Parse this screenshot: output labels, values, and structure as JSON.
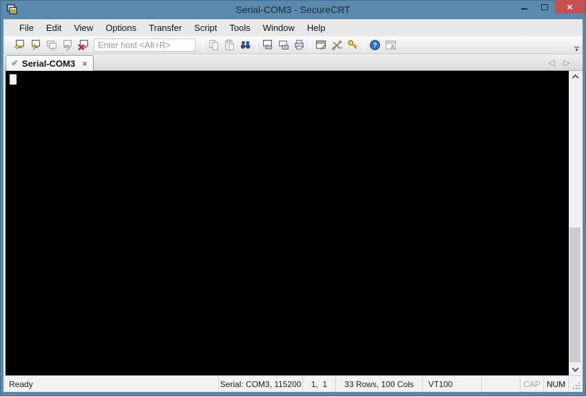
{
  "window": {
    "title": "Serial-COM3 - SecureCRT",
    "app_icon": "securecrt-stacked-windows",
    "controls": [
      "minimize",
      "maximize",
      "close"
    ],
    "close_glyph": "×"
  },
  "menu": {
    "items": [
      "File",
      "Edit",
      "View",
      "Options",
      "Transfer",
      "Script",
      "Tools",
      "Window",
      "Help"
    ]
  },
  "toolbar": {
    "host_placeholder": "Enter host <Alt+R>",
    "host_value": "",
    "overflow_glyph": "▾",
    "icons": [
      {
        "name": "quick-connect-icon",
        "enabled": true
      },
      {
        "name": "connect-icon",
        "enabled": true
      },
      {
        "name": "connect-in-tab-icon",
        "enabled": false
      },
      {
        "name": "reconnect-icon",
        "enabled": false
      },
      {
        "name": "disconnect-icon",
        "enabled": true
      },
      {
        "name": "copy-icon",
        "enabled": false
      },
      {
        "name": "paste-icon",
        "enabled": false
      },
      {
        "name": "find-icon",
        "enabled": true
      },
      {
        "name": "print-screen-icon",
        "enabled": true
      },
      {
        "name": "auto-print-icon",
        "enabled": true
      },
      {
        "name": "print-icon",
        "enabled": true
      },
      {
        "name": "session-options-icon",
        "enabled": true
      },
      {
        "name": "global-options-icon",
        "enabled": true
      },
      {
        "name": "key-agent-icon",
        "enabled": true
      },
      {
        "name": "help-icon",
        "enabled": true
      },
      {
        "name": "font-window-icon",
        "enabled": false
      }
    ]
  },
  "tabbar": {
    "tabs": [
      {
        "label": "Serial-COM3",
        "state": "connected",
        "check_glyph": "✔",
        "close_glyph": "×",
        "active": true
      }
    ],
    "nav_prev_glyph": "◁",
    "nav_next_glyph": "▷"
  },
  "terminal": {
    "content": "",
    "cursor_visible": true
  },
  "statusbar": {
    "ready": "Ready",
    "connection": "Serial: COM3, 115200",
    "cursor_position": "1,  1",
    "dimensions": "33 Rows, 100 Cols",
    "emulation": "VT100",
    "caps_lock": "CAP",
    "num_lock": "NUM",
    "caps_lock_on": false,
    "num_lock_on": true
  },
  "colors": {
    "titlebar": "#5a8aad",
    "close_button": "#c75050",
    "terminal_bg": "#000000",
    "connected_check": "#3fae49",
    "chrome_bg": "#f0f0f0"
  }
}
